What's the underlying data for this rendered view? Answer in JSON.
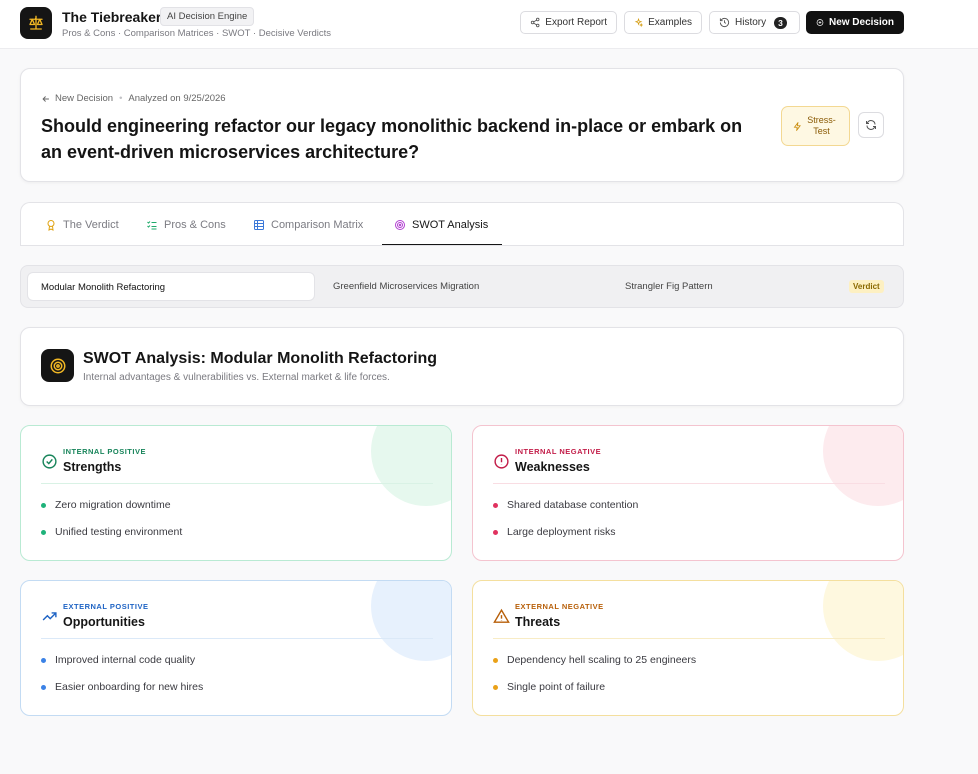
{
  "header": {
    "title": "The Tiebreaker",
    "badge": "AI Decision Engine",
    "subtitle": "Pros & Cons · Comparison Matrices · SWOT · Decisive Verdicts",
    "export_label": "Export Report",
    "examples_label": "Examples",
    "history_label": "History",
    "history_count": "3",
    "new_decision_label": "New Decision"
  },
  "question": {
    "back_label": "New Decision",
    "analyzed": "Analyzed on 9/25/2026",
    "text": "Should engineering refactor our legacy monolithic backend in-place or embark on an event-driven microservices architecture?",
    "stress_test_label": "Stress-Test"
  },
  "tabs": [
    {
      "label": "The Verdict",
      "icon": "trophy-icon"
    },
    {
      "label": "Pros & Cons",
      "icon": "checklist-icon"
    },
    {
      "label": "Comparison Matrix",
      "icon": "grid-icon"
    },
    {
      "label": "SWOT Analysis",
      "icon": "target-icon",
      "active": true
    }
  ],
  "options": [
    {
      "label": "Modular Monolith Refactoring",
      "active": true
    },
    {
      "label": "Greenfield Microservices Migration"
    },
    {
      "label": "Strangler Fig Pattern",
      "badge": "Verdict"
    }
  ],
  "swot": {
    "title": "SWOT Analysis: Modular Monolith Refactoring",
    "subtitle": "Internal advantages & vulnerabilities vs. External market & life forces.",
    "strengths": {
      "kicker": "INTERNAL POSITIVE",
      "heading": "Strengths",
      "items": [
        "Zero migration downtime",
        "Unified testing environment"
      ]
    },
    "weaknesses": {
      "kicker": "INTERNAL NEGATIVE",
      "heading": "Weaknesses",
      "items": [
        "Shared database contention",
        "Large deployment risks"
      ]
    },
    "opportunities": {
      "kicker": "EXTERNAL POSITIVE",
      "heading": "Opportunities",
      "items": [
        "Improved internal code quality",
        "Easier onboarding for new hires"
      ]
    },
    "threats": {
      "kicker": "EXTERNAL NEGATIVE",
      "heading": "Threats",
      "items": [
        "Dependency hell scaling to 25 engineers",
        "Single point of failure"
      ]
    }
  },
  "colors": {
    "accent": "#151515",
    "strengths": "#1fb27a",
    "weaknesses": "#e0325f",
    "opportunities": "#3b82e6",
    "threats": "#eaa118",
    "stress_test": "#fef8e3"
  }
}
